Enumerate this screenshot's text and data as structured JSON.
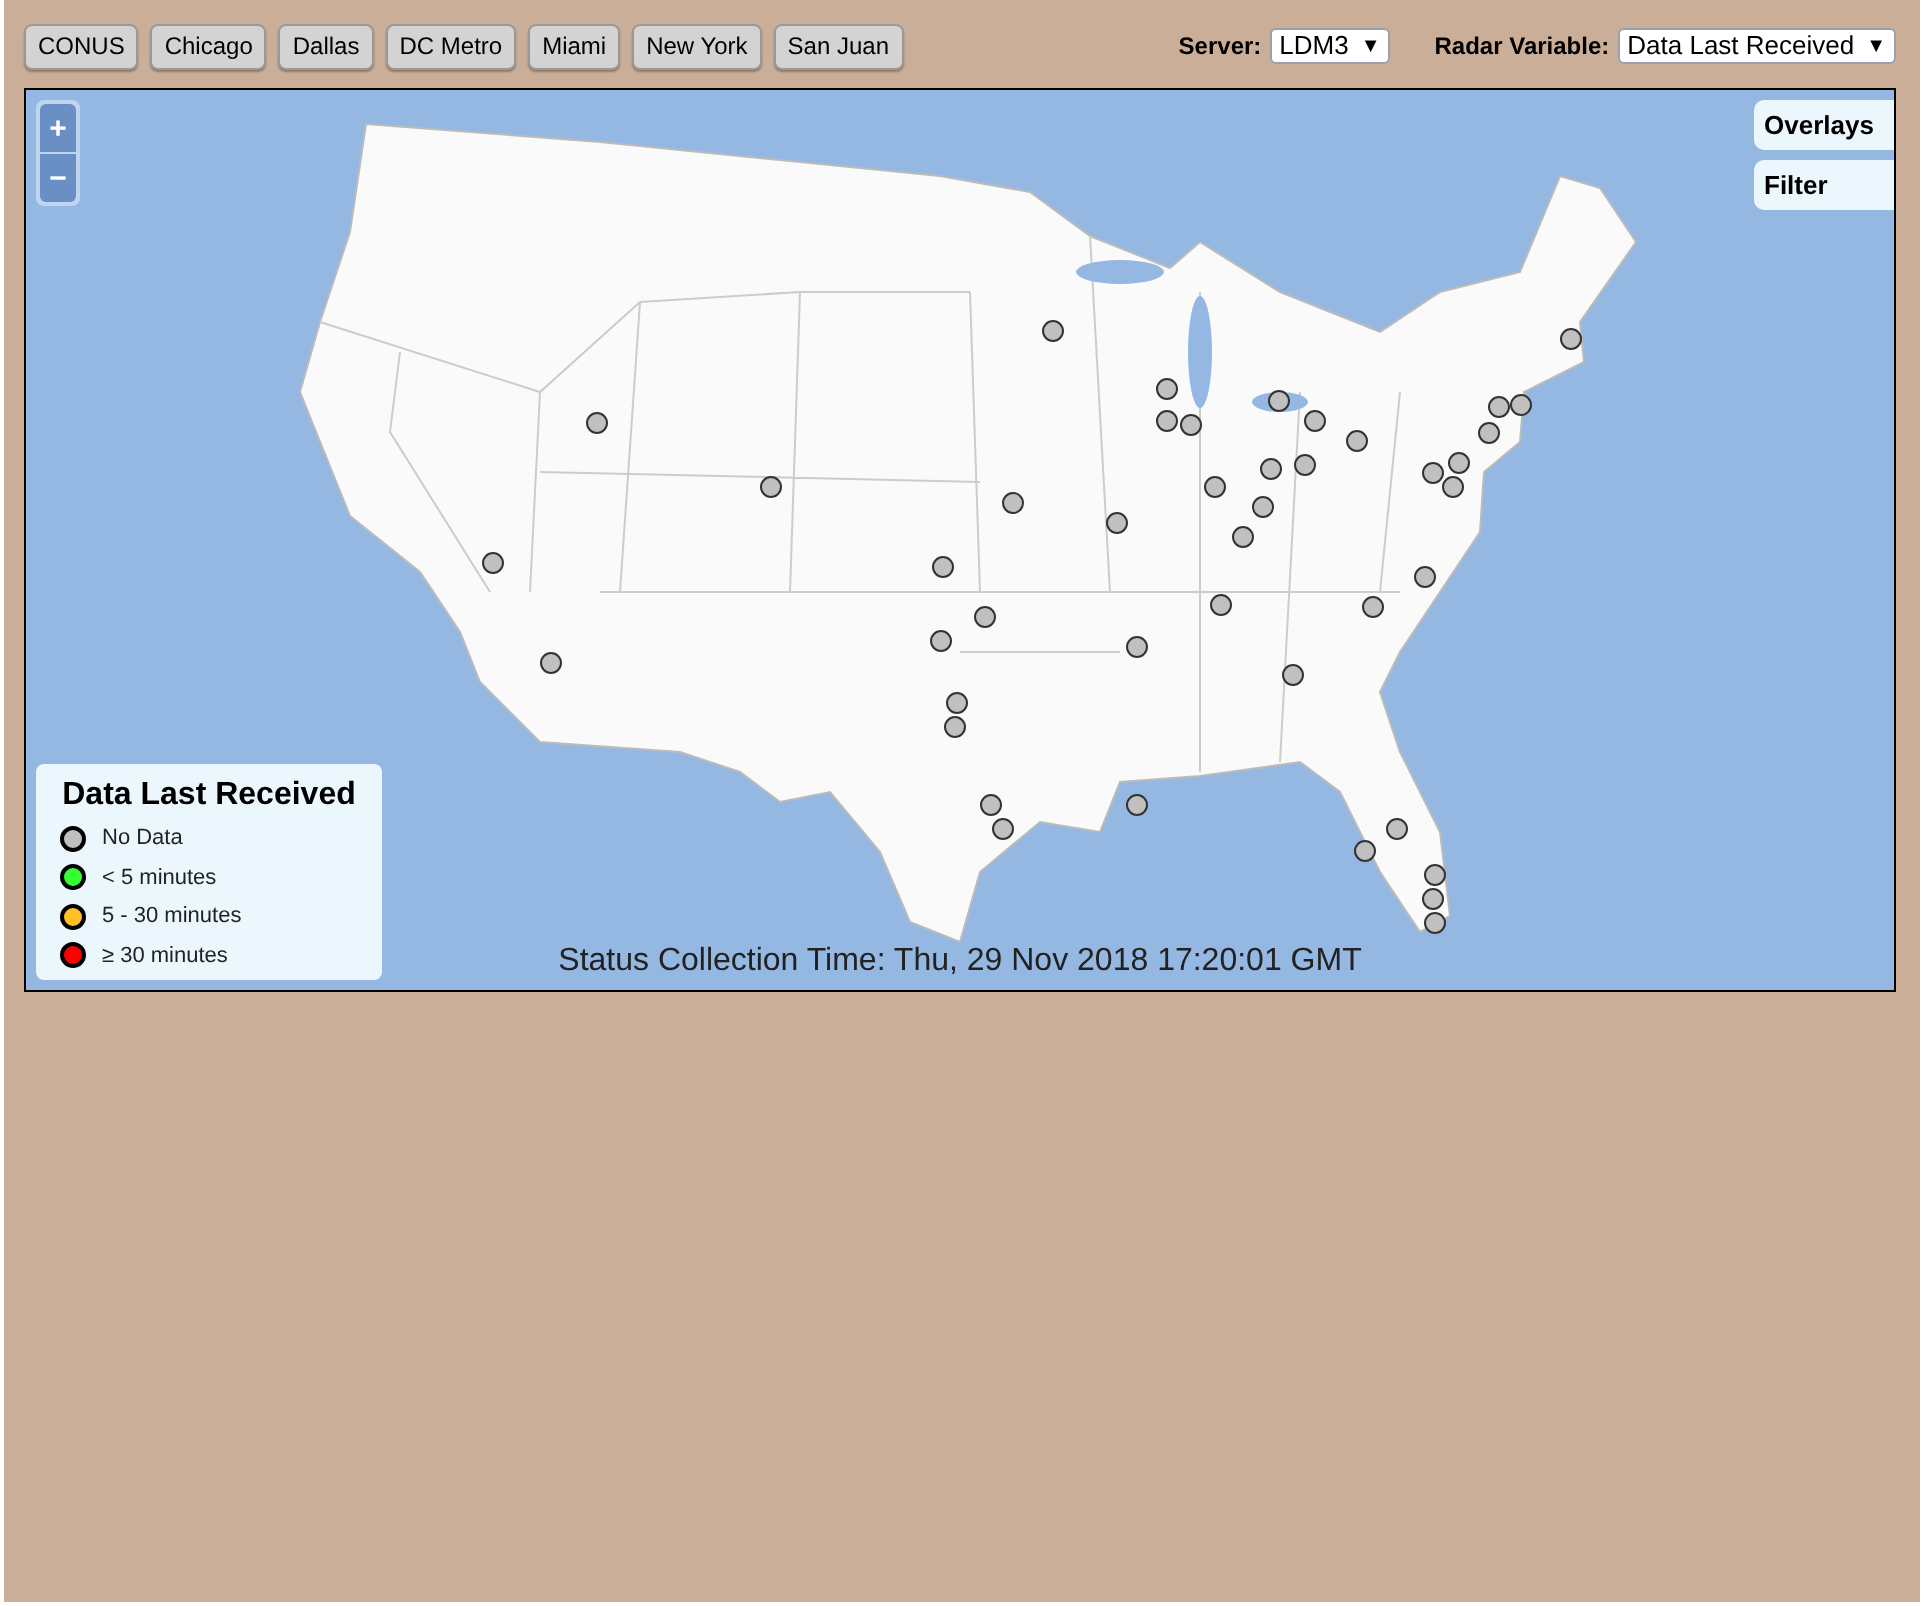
{
  "region_buttons": [
    "CONUS",
    "Chicago",
    "Dallas",
    "DC Metro",
    "Miami",
    "New York",
    "San Juan"
  ],
  "server": {
    "label": "Server:",
    "value": "LDM3",
    "arrow": "▼"
  },
  "radar_variable": {
    "label": "Radar Variable:",
    "value": "Data Last Received",
    "arrow": "▼"
  },
  "map": {
    "zoom_in": "+",
    "zoom_out": "−",
    "panels": [
      "Overlays",
      "Filter"
    ],
    "status": "Status Collection Time: Thu, 29 Nov 2018 17:20:01 GMT",
    "legend": {
      "title": "Data Last Received",
      "items": [
        {
          "label": "No Data",
          "color": "#c0c0c0"
        },
        {
          "label": "< 5 minutes",
          "color": "#33ff33"
        },
        {
          "label": "5 - 30 minutes",
          "color": "#ffc125"
        },
        {
          "label": "≥ 30 minutes",
          "color": "#ff0000"
        }
      ]
    },
    "sites": [
      {
        "color": "#c0c0c0"
      },
      {
        "color": "#c0c0c0"
      },
      {
        "color": "#c0c0c0"
      },
      {
        "color": "#c0c0c0"
      },
      {
        "color": "#c0c0c0"
      },
      {
        "color": "#c0c0c0"
      },
      {
        "color": "#c0c0c0"
      },
      {
        "color": "#c0c0c0"
      },
      {
        "color": "#c0c0c0"
      },
      {
        "color": "#c0c0c0"
      },
      {
        "color": "#c0c0c0"
      },
      {
        "color": "#c0c0c0"
      },
      {
        "color": "#c0c0c0"
      },
      {
        "color": "#c0c0c0"
      },
      {
        "color": "#c0c0c0"
      },
      {
        "color": "#c0c0c0"
      },
      {
        "color": "#c0c0c0"
      },
      {
        "color": "#c0c0c0"
      },
      {
        "color": "#c0c0c0"
      },
      {
        "color": "#c0c0c0"
      },
      {
        "color": "#c0c0c0"
      },
      {
        "color": "#c0c0c0"
      },
      {
        "color": "#c0c0c0"
      },
      {
        "color": "#c0c0c0"
      },
      {
        "color": "#c0c0c0"
      },
      {
        "color": "#c0c0c0"
      },
      {
        "color": "#c0c0c0"
      },
      {
        "color": "#c0c0c0"
      },
      {
        "color": "#c0c0c0"
      },
      {
        "color": "#c0c0c0"
      },
      {
        "color": "#c0c0c0"
      },
      {
        "color": "#c0c0c0"
      },
      {
        "color": "#c0c0c0"
      },
      {
        "color": "#c0c0c0"
      },
      {
        "color": "#c0c0c0"
      },
      {
        "color": "#c0c0c0"
      },
      {
        "color": "#c0c0c0"
      },
      {
        "color": "#c0c0c0"
      },
      {
        "color": "#c0c0c0"
      },
      {
        "color": "#c0c0c0"
      },
      {
        "color": "#c0c0c0"
      },
      {
        "color": "#c0c0c0"
      },
      {
        "color": "#c0c0c0"
      }
    ]
  }
}
